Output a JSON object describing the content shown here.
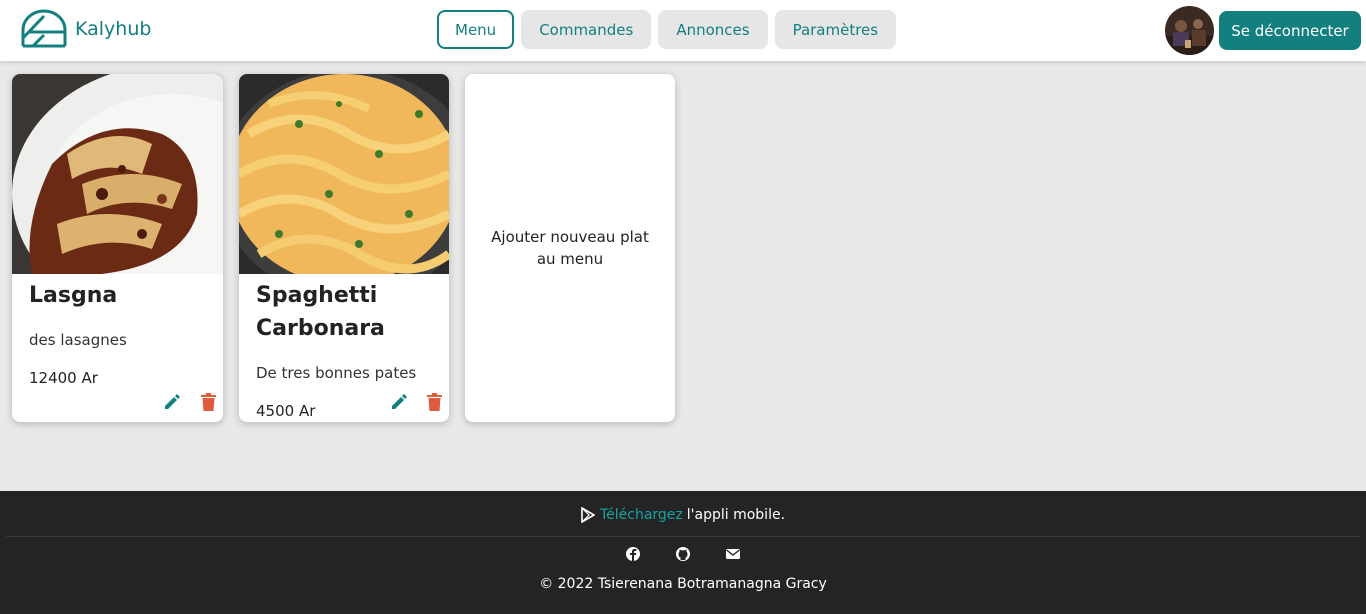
{
  "header": {
    "brand": "Kalyhub",
    "nav": [
      {
        "label": "Menu",
        "active": true
      },
      {
        "label": "Commandes",
        "active": false
      },
      {
        "label": "Annonces",
        "active": false
      },
      {
        "label": "Paramètres",
        "active": false
      }
    ],
    "logout_label": "Se déconnecter"
  },
  "dishes": [
    {
      "title": "Lasgna",
      "description": "des lasagnes",
      "price": "12400 Ar"
    },
    {
      "title_line1": "Spaghetti",
      "title_line2": "Carbonara",
      "description": "De tres bonnes pates",
      "price": "4500 Ar"
    }
  ],
  "add_card": {
    "label": "Ajouter nouveau plat au menu"
  },
  "footer": {
    "promo_link": "Téléchargez",
    "promo_text": "l'appli mobile.",
    "copyright": "© 2022 Tsierenana Botramanagna Gracy"
  },
  "colors": {
    "accent": "#137f7f",
    "danger": "#e05a3c",
    "footer_bg": "#242424"
  }
}
